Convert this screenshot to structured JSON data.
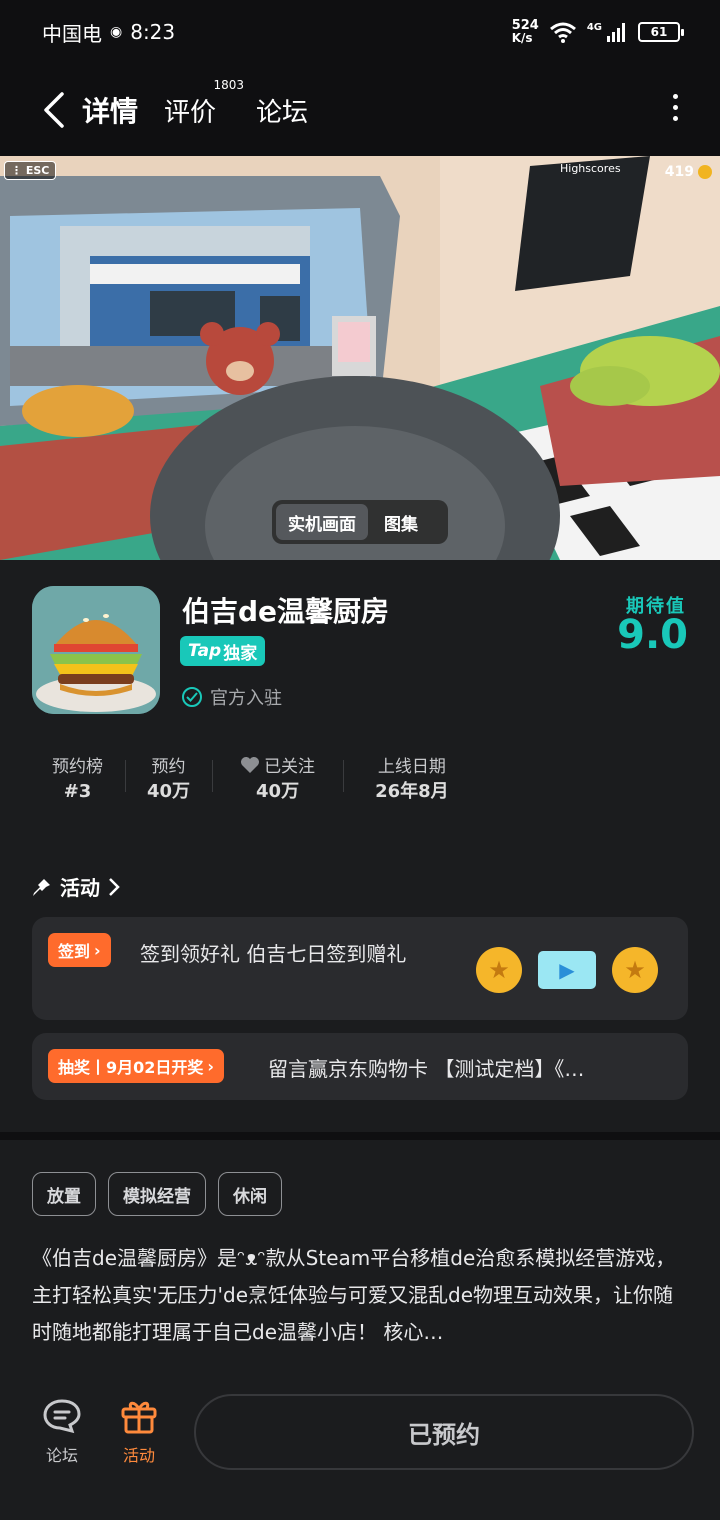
{
  "status_bar": {
    "carrier": "中国电",
    "time": "8:23",
    "net_speed_value": "524",
    "net_speed_unit": "K/s",
    "network_type": "4G",
    "battery": "61"
  },
  "header": {
    "tabs": [
      {
        "label": "详情",
        "active": true
      },
      {
        "label": "评价",
        "count": "1803"
      },
      {
        "label": "论坛"
      }
    ]
  },
  "hero": {
    "esc_label": "ESC",
    "coin_count": "419",
    "media_options": [
      "实机画面",
      "图集"
    ],
    "media_selected": "实机画面",
    "scene_board_title": "Highscores"
  },
  "game": {
    "title": "伯吉de温馨厨房",
    "badge_brand": "Tap",
    "badge_text": "独家",
    "official_text": "官方入驻",
    "expect_label": "期待值",
    "expect_score": "9.0",
    "stats": [
      {
        "label": "预约榜",
        "value": "#3"
      },
      {
        "label": "预约",
        "value": "40万"
      },
      {
        "label": "已关注",
        "value": "40万"
      },
      {
        "label": "上线日期",
        "value": "26年8月"
      }
    ]
  },
  "activity": {
    "heading": "活动",
    "cards": [
      {
        "pill": "签到",
        "text": "签到领好礼 伯吉七日签到赠礼"
      },
      {
        "pill": "抽奖丨9月02日开奖",
        "text": "留言赢京东购物卡 【测试定档】《…"
      }
    ]
  },
  "description": {
    "tags": [
      "放置",
      "模拟经营",
      "休闲"
    ],
    "text": "《伯吉de温馨厨房》是ᵔᴥᵔ款从Steam平台移植de治愈系模拟经营游戏，主打轻松真实'无压力'de烹饪体验与可爱又混乱de物理互动效果，让你随时随地都能打理属于自己de温馨小店！ 核心…"
  },
  "bottom_bar": {
    "forum_label": "论坛",
    "event_label": "活动",
    "reserve_label": "已预约"
  },
  "colors": {
    "accent": "#19c8b9",
    "orange": "#ff6b2c",
    "background": "#1b1c1e"
  }
}
